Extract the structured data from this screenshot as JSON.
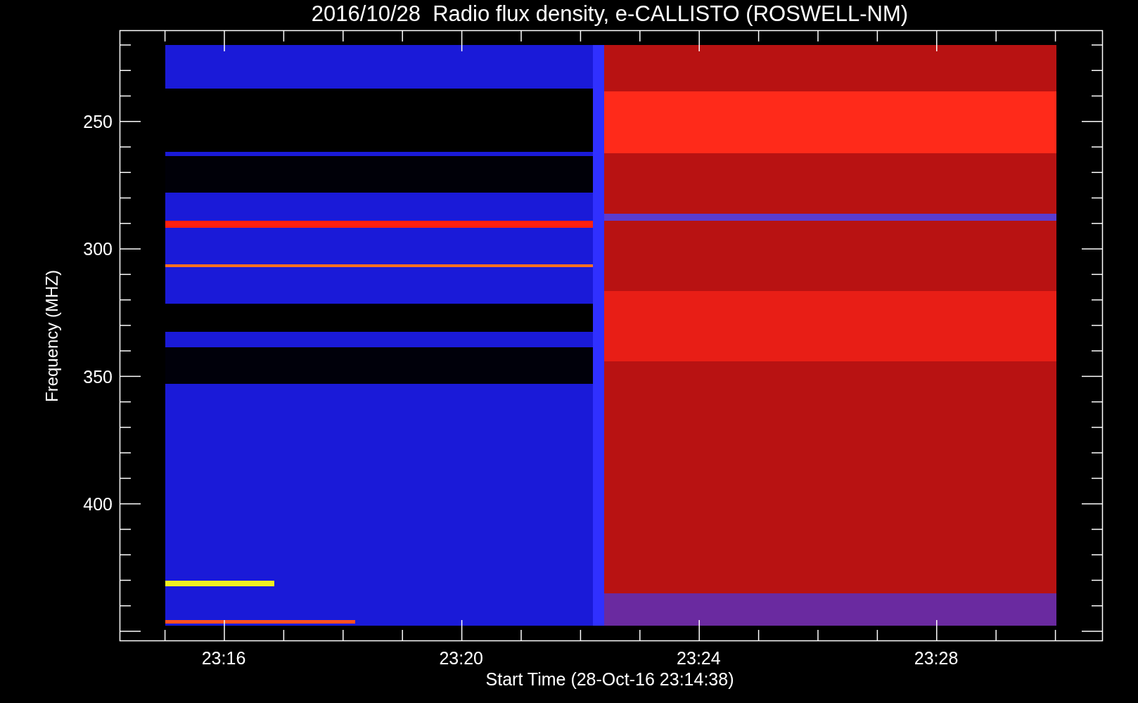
{
  "title": "2016/10/28  Radio flux density, e-CALLISTO (ROSWELL-NM)",
  "y_axis": {
    "label": "Frequency (MHZ)",
    "ticks": [
      "250",
      "300",
      "350",
      "400"
    ]
  },
  "x_axis": {
    "label": "Start Time (28-Oct-16 23:14:38)",
    "ticks": [
      "23:16",
      "23:20",
      "23:24",
      "23:28"
    ]
  }
}
